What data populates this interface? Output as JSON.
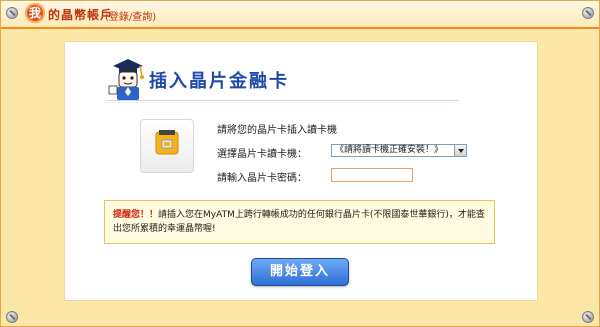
{
  "header": {
    "badge": "我",
    "title": "的晶幣帳戶",
    "subtitle": "(登錄/查詢)"
  },
  "main": {
    "heading": "插入晶片金融卡",
    "instruction": "請將您的晶片卡插入讀卡機",
    "reader_label": "選擇晶片卡讀卡機：",
    "reader_select_value": "《請將讀卡機正確安裝！》",
    "pin_label": "請輸入晶片卡密碼："
  },
  "notice": {
    "lead": "提醒您！！",
    "text": "請插入您在MyATM上跨行轉帳成功的任何銀行晶片卡(不限國泰世華銀行)，才能查出您所累積的幸運晶幣喔!"
  },
  "actions": {
    "login_label": "開始登入"
  },
  "colors": {
    "frame_bg": "#fde7a8",
    "title_red": "#c0320f",
    "heading_blue": "#1f4aa8",
    "button_blue": "#2f6fd6",
    "notice_red": "#d1240e"
  }
}
